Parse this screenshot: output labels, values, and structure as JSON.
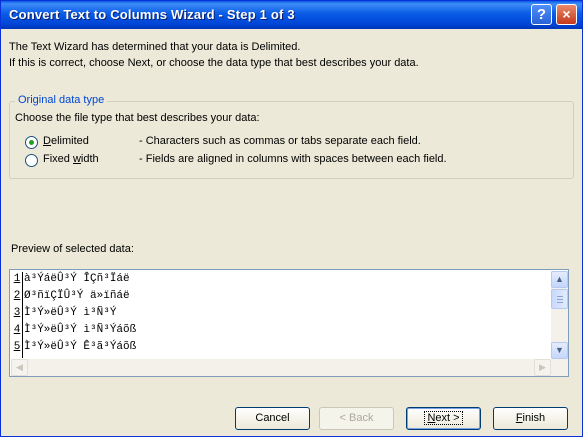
{
  "window": {
    "title": "Convert Text to Columns Wizard - Step 1 of 3",
    "help_glyph": "?",
    "close_glyph": "×"
  },
  "intro": {
    "line1": "The Text Wizard has determined that your data is Delimited.",
    "line2": "If this is correct, choose Next, or choose the data type that best describes your data."
  },
  "data_type_group": {
    "legend": "Original data type",
    "prompt": "Choose the file type that best describes your data:",
    "options": [
      {
        "label_pre": "",
        "label_key": "D",
        "label_post": "elimited",
        "description": "- Characters such as commas or tabs separate each field.",
        "selected": true
      },
      {
        "label_pre": "Fixed ",
        "label_key": "w",
        "label_post": "idth",
        "description": "- Fields are aligned in columns with spaces between each field.",
        "selected": false
      }
    ]
  },
  "preview": {
    "label": "Preview of selected data:",
    "rows": [
      {
        "num": "1",
        "text": "à³ÝáëÛ³Ý ÎÇñ³Ïáë"
      },
      {
        "num": "2",
        "text": "Ø³ñïÇÏÛ³Ý ä»ïñáë"
      },
      {
        "num": "3",
        "text": "Ì³Ý»ëÛ³Ý ì³Ñ³Ý"
      },
      {
        "num": "4",
        "text": "Ì³Ý»ëÛ³Ý ì³Ñ³Ýáõß"
      },
      {
        "num": "5",
        "text": "Ì³Ý»ëÛ³Ý Ê³ã³Ýáõß"
      }
    ]
  },
  "scroll_glyphs": {
    "up": "▲",
    "down": "▼",
    "left": "◀",
    "right": "▶"
  },
  "buttons": {
    "cancel": {
      "label": "Cancel"
    },
    "back": {
      "label": "< Back",
      "enabled": false
    },
    "next": {
      "pre": "",
      "key": "N",
      "post": "ext >"
    },
    "finish": {
      "pre": "",
      "key": "F",
      "post": "inish"
    }
  },
  "colors": {
    "title_bar": "#0a5ce6",
    "face": "#ece9d8",
    "group_legend": "#0046d5",
    "radio_dot": "#21a121"
  }
}
